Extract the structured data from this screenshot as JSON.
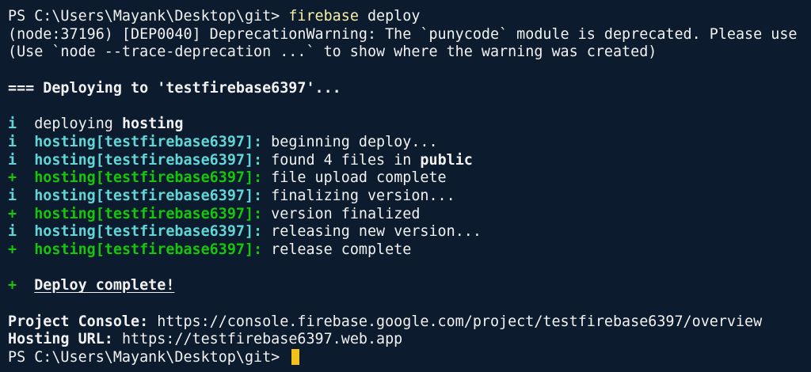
{
  "terminal": {
    "prompt1": "PS C:\\Users\\Mayank\\Desktop\\git> ",
    "command_name": "firebase",
    "command_args": " deploy",
    "warning_line1": "(node:37196) [DEP0040] DeprecationWarning: The `punycode` module is deprecated. Please use",
    "warning_line2": "(Use `node --trace-deprecation ...` to show where the warning was created)",
    "deploying_header": "=== Deploying to 'testfirebase6397'...",
    "deploy_line": {
      "prefix": "i",
      "text": "  deploying ",
      "target": "hosting"
    },
    "steps": [
      {
        "prefix": "i",
        "tag": "hosting[testfirebase6397]:",
        "message": " beginning deploy...",
        "status": "info"
      },
      {
        "prefix": "i",
        "tag": "hosting[testfirebase6397]:",
        "message": " found 4 files in ",
        "message_bold": "public",
        "status": "info"
      },
      {
        "prefix": "+",
        "tag": "hosting[testfirebase6397]:",
        "message": " file upload complete",
        "status": "ok"
      },
      {
        "prefix": "i",
        "tag": "hosting[testfirebase6397]:",
        "message": " finalizing version...",
        "status": "info"
      },
      {
        "prefix": "+",
        "tag": "hosting[testfirebase6397]:",
        "message": " version finalized",
        "status": "ok"
      },
      {
        "prefix": "i",
        "tag": "hosting[testfirebase6397]:",
        "message": " releasing new version...",
        "status": "info"
      },
      {
        "prefix": "+",
        "tag": "hosting[testfirebase6397]:",
        "message": " release complete",
        "status": "ok"
      }
    ],
    "complete": {
      "prefix": "+",
      "text": "Deploy complete!"
    },
    "project_console_label": "Project Console:",
    "project_console_url": " https://console.firebase.google.com/project/testfirebase6397/overview",
    "hosting_url_label": "Hosting URL:",
    "hosting_url": " https://testfirebase6397.web.app",
    "prompt2": "PS C:\\Users\\Mayank\\Desktop\\git> "
  },
  "colors": {
    "background": "#0c1b2e",
    "foreground": "#f2f2f2",
    "info_cyan": "#61d6d6",
    "success_green": "#16c60c",
    "command_yellow": "#f9f1a5",
    "cursor": "#f2c21a"
  }
}
